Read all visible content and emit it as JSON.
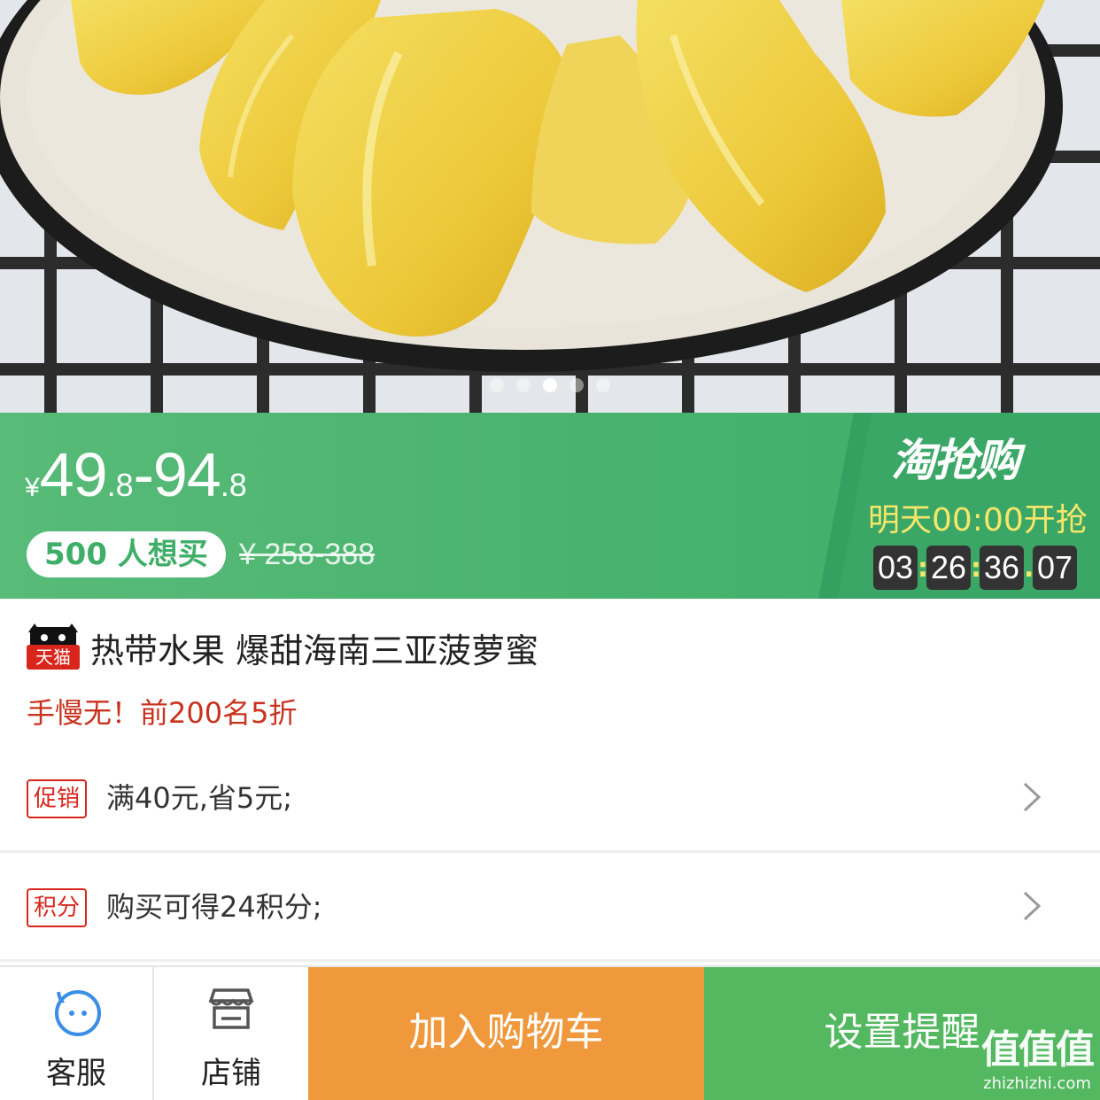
{
  "hero": {
    "dots_total": 5,
    "dots_active_index": 2
  },
  "price": {
    "currency": "¥",
    "low_int": "49",
    "low_dec": ".8",
    "dash": "-",
    "high_int": "94",
    "high_dec": ".8",
    "want_count": "500 人想买",
    "original_price": "¥ 258-388"
  },
  "flash_sale": {
    "brand": "淘抢购",
    "start_text": "明天00:00开抢",
    "countdown": [
      "03",
      "26",
      "36",
      "07"
    ],
    "separators": [
      ":",
      ":",
      "."
    ]
  },
  "product": {
    "badge": "天猫",
    "title": "热带水果 爆甜海南三亚菠萝蜜",
    "subtitle": "手慢无！前200名5折"
  },
  "promotions": [
    {
      "tag": "促销",
      "text": "满40元,省5元;"
    },
    {
      "tag": "积分",
      "text": "购买可得24积分;"
    }
  ],
  "bottom_bar": {
    "service_label": "客服",
    "shop_label": "店铺",
    "cart_label": "加入购物车",
    "remind_label": "设置提醒"
  },
  "watermark": {
    "line1": "值值值",
    "line2": "zhizhizhi.com"
  },
  "colors": {
    "banner_green": "#4fb873",
    "cart_orange": "#f0983c",
    "remind_green": "#53b860",
    "tag_red": "#d9261c",
    "countdown_yellow": "#f7e66a"
  }
}
